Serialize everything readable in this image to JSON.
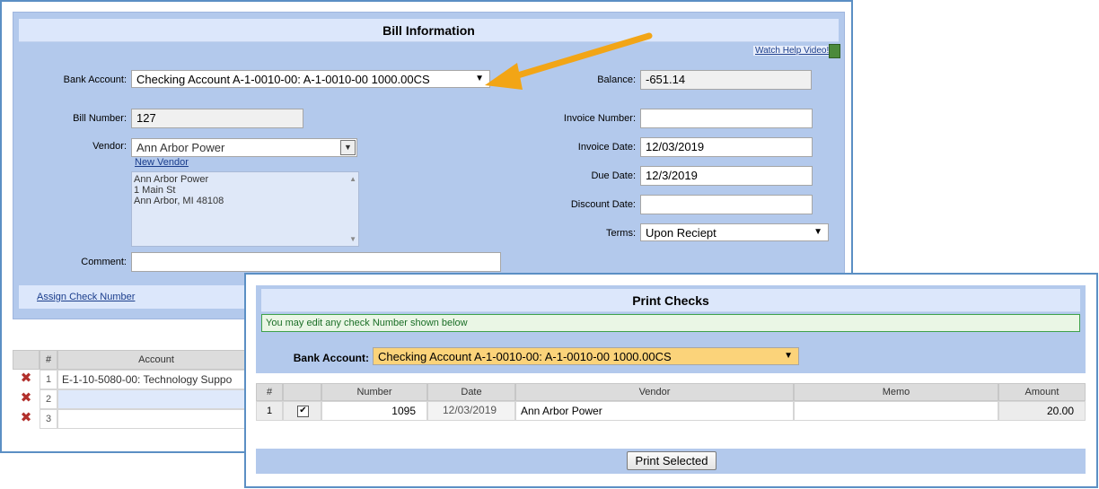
{
  "bill": {
    "title": "Bill Information",
    "help_link": "Watch Help Video!",
    "bank_account_label": "Bank Account:",
    "bank_account_value": "Checking Account A-1-0010-00: A-1-0010-00 1000.00CS",
    "balance_label": "Balance:",
    "balance_value": "-651.14",
    "bill_number_label": "Bill Number:",
    "bill_number_value": "127",
    "vendor_label": "Vendor:",
    "vendor_value": "Ann Arbor Power",
    "new_vendor_link": "New Vendor",
    "vendor_address": [
      "Ann Arbor Power",
      "1 Main St",
      "Ann Arbor, MI 48108"
    ],
    "invoice_number_label": "Invoice Number:",
    "invoice_number_value": "",
    "invoice_date_label": "Invoice Date:",
    "invoice_date_value": "12/03/2019",
    "due_date_label": "Due Date:",
    "due_date_value": "12/3/2019",
    "discount_date_label": "Discount Date:",
    "discount_date_value": "",
    "terms_label": "Terms:",
    "terms_value": "Upon Reciept",
    "comment_label": "Comment:",
    "comment_value": "",
    "assign_check_link": "Assign Check Number"
  },
  "lines": {
    "headers": {
      "num": "#",
      "account": "Account"
    },
    "rows": [
      {
        "num": "1",
        "account": "E-1-10-5080-00: Technology Suppo"
      },
      {
        "num": "2",
        "account": ""
      },
      {
        "num": "3",
        "account": ""
      }
    ]
  },
  "print": {
    "title": "Print Checks",
    "notice": "You may edit any check Number shown below",
    "bank_account_label": "Bank Account:",
    "bank_account_value": "Checking Account A-1-0010-00: A-1-0010-00 1000.00CS",
    "headers": {
      "num": "#",
      "check": "",
      "number": "Number",
      "date": "Date",
      "vendor": "Vendor",
      "memo": "Memo",
      "amount": "Amount"
    },
    "rows": [
      {
        "num": "1",
        "number": "1095",
        "date": "12/03/2019",
        "vendor": "Ann Arbor Power",
        "memo": "",
        "amount": "20.00"
      }
    ],
    "print_button": "Print Selected"
  },
  "colors": {
    "panel": "#b3c9ec",
    "accent_border": "#5b8fc4",
    "arrow": "#f2a516",
    "highlight_select": "#fbd37a"
  }
}
